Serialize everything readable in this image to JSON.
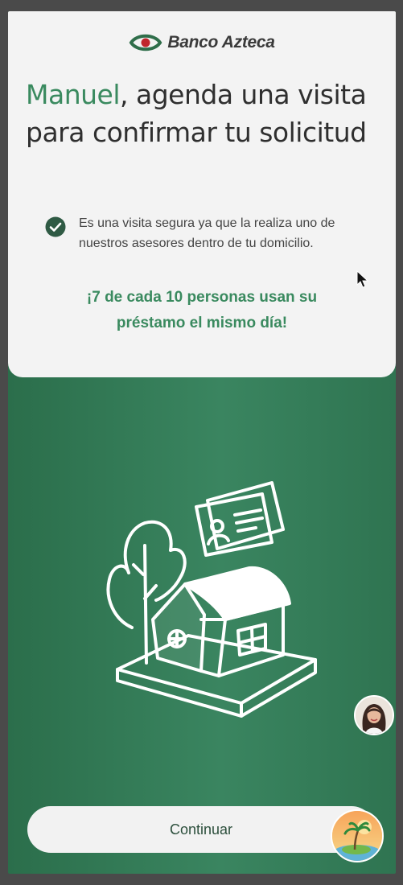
{
  "brand": {
    "name": "Banco Azteca",
    "logo_color": "#c0272d"
  },
  "headline": {
    "name": "Manuel",
    "rest": ", agenda una visita para confirmar tu solicitud"
  },
  "bullet": {
    "text": "Es una visita segura ya que la realiza uno de nuestros asesores dentro de tu domicilio."
  },
  "promo": {
    "line1": "¡7 de cada 10 personas usan su",
    "line2": "préstamo el mismo día!"
  },
  "actions": {
    "continue_label": "Continuar"
  },
  "colors": {
    "accent_green": "#3a8a5f",
    "background_green": "#2f7451"
  },
  "icons": {
    "check": "check-circle-icon",
    "illustration": "house-with-id-card-illustration",
    "chat": "assistant-avatar",
    "fab": "beach-island-icon"
  }
}
